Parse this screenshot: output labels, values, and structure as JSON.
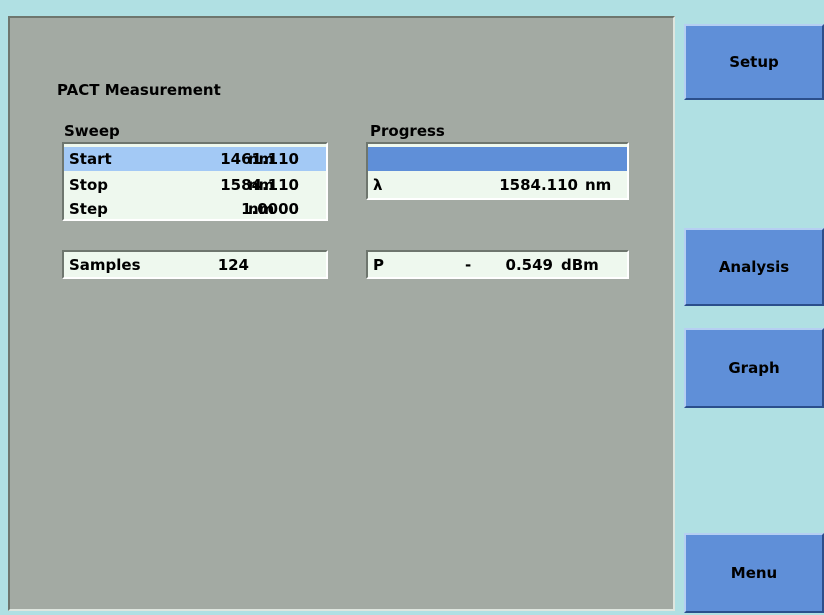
{
  "screen": {
    "title": "PACT Measurement",
    "sweep": {
      "label": "Sweep",
      "rows": [
        {
          "name": "Start",
          "value": "1461.110",
          "unit": "nm"
        },
        {
          "name": "Stop",
          "value": "1584.110",
          "unit": "nm"
        },
        {
          "name": "Step",
          "value": "1.0000",
          "unit": "nm"
        }
      ]
    },
    "samples": {
      "label": "Samples",
      "value": "124"
    },
    "progress": {
      "label": "Progress",
      "level": 1.0,
      "lambda": {
        "symbol": "λ",
        "value": "1584.110",
        "unit": "nm"
      }
    },
    "power": {
      "symbol": "P",
      "sign": "-",
      "value": "0.549",
      "unit": "dBm"
    }
  },
  "softkeys": {
    "setup": "Setup",
    "analysis": "Analysis",
    "graph": "Graph",
    "menu": "Menu"
  },
  "colors": {
    "background": "#b0e0e3",
    "panel": "#a3aaa3",
    "field": "#eef8ee",
    "selected": "#a3c9f5",
    "accent": "#5f8fd8"
  }
}
